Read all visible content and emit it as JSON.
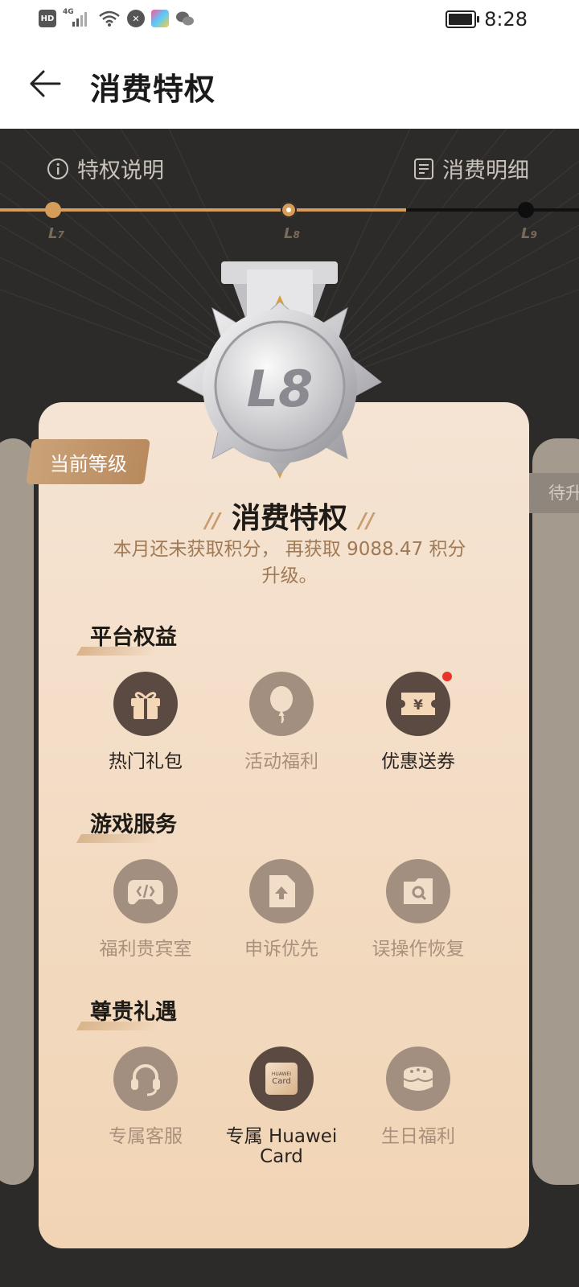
{
  "status": {
    "time": "8:28",
    "network": "4G",
    "hd": "HD"
  },
  "header": {
    "title": "消费特权"
  },
  "links": {
    "rules": "特权说明",
    "details": "消费明细"
  },
  "levels": [
    {
      "label": "L",
      "num": "7",
      "state": "passed"
    },
    {
      "label": "L",
      "num": "8",
      "state": "current"
    },
    {
      "label": "L",
      "num": "9",
      "state": "next"
    }
  ],
  "medal": {
    "text": "L8"
  },
  "badge": {
    "current": "当前等级",
    "pending": "待升"
  },
  "card": {
    "title": "消费特权",
    "desc": "本月还未获取积分， 再获取 9088.47 积分升级。"
  },
  "sections": [
    {
      "title": "平台权益",
      "items": [
        {
          "label": "热门礼包",
          "icon": "gift-icon",
          "active": true
        },
        {
          "label": "活动福利",
          "icon": "balloon-icon",
          "active": false
        },
        {
          "label": "优惠送券",
          "icon": "coupon-icon",
          "active": true,
          "dot": true
        }
      ]
    },
    {
      "title": "游戏服务",
      "items": [
        {
          "label": "福利贵宾室",
          "icon": "gamepad-icon",
          "active": false
        },
        {
          "label": "申诉优先",
          "icon": "upload-file-icon",
          "active": false
        },
        {
          "label": "误操作恢复",
          "icon": "restore-folder-icon",
          "active": false
        }
      ]
    },
    {
      "title": "尊贵礼遇",
      "items": [
        {
          "label": "专属客服",
          "icon": "headset-icon",
          "active": false
        },
        {
          "label": "专属 Huawei Card",
          "icon": "huawei-card-icon",
          "active": true,
          "card_line1": "HUAWEI",
          "card_line2": "Card"
        },
        {
          "label": "生日福利",
          "icon": "cake-icon",
          "active": false
        }
      ]
    }
  ],
  "colors": {
    "accent": "#d59c5a",
    "dark_icon": "#5a4a42",
    "muted_icon": "#a38f80",
    "desc": "#a07a55"
  }
}
